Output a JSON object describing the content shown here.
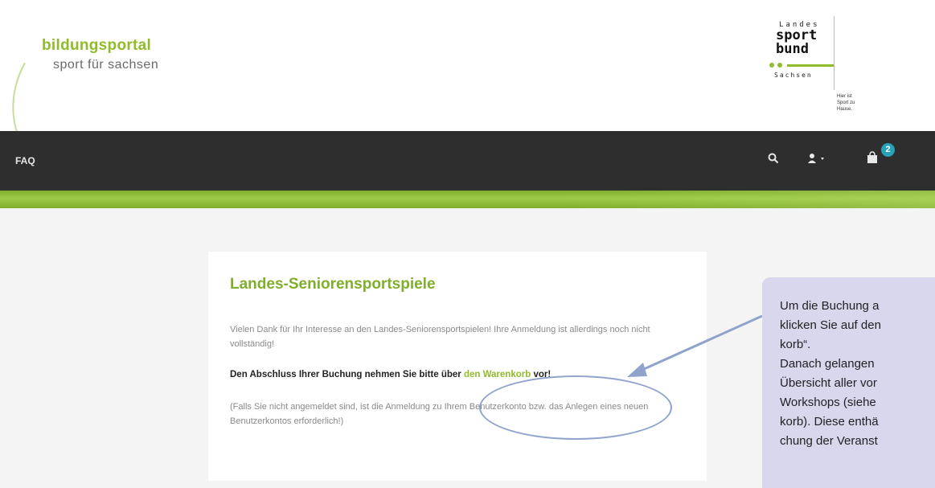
{
  "header": {
    "brand_title": "bildungsportal",
    "brand_subtitle": "sport für sachsen",
    "partner_logo": {
      "line1": "Landes",
      "line2": "sport",
      "line3": "bund",
      "line4": "Sachsen",
      "slogan": "Hier ist\nSport zu Hause."
    }
  },
  "nav": {
    "faq": "FAQ",
    "search_icon": "search-icon",
    "user_icon": "user-icon",
    "cart_icon": "shopping-bag-icon",
    "cart_count": "2"
  },
  "card": {
    "title": "Landes-Seniorensportspiele",
    "paragraph1": "Vielen Dank für Ihr Interesse an den Landes-Seniorensportspielen! Ihre Anmeldung ist allerdings noch nicht vollständig!",
    "paragraph2_pre": "Den Abschluss Ihrer Buchung nehmen Sie bitte über",
    "paragraph2_link": "den Warenkorb",
    "paragraph2_post": "vor!",
    "paragraph3": "(Falls Sie nicht angemeldet sind, ist die Anmeldung zu Ihrem Benutzerkonto bzw. das Anlegen eines neuen Benutzerkontos erforderlich!)"
  },
  "callout": {
    "lines": [
      "Um die Buchung a",
      "klicken Sie auf den",
      "korb“.",
      "Danach gelangen",
      "Übersicht aller vor",
      "Workshops (siehe",
      "korb). Diese enthä",
      "chung der Veranst"
    ]
  },
  "colors": {
    "accent_green": "#8fbc2a",
    "nav_dark": "#2e2e2e",
    "badge": "#27a2b8",
    "callout_bg": "#d9d7ee",
    "annotation": "#8fa3cc"
  }
}
